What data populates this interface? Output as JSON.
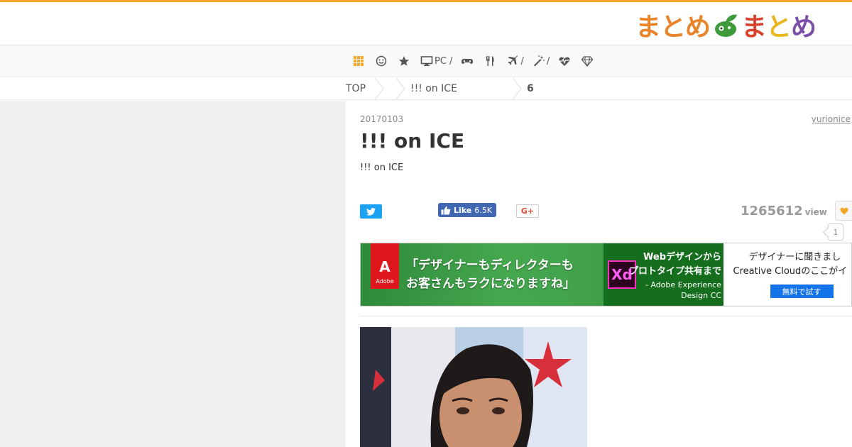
{
  "colors": {
    "accent": "#f5a623",
    "twitter": "#1da1f2",
    "facebook": "#4267b2",
    "google": "#dd4b39"
  },
  "logo": {
    "text_1": "まとめ",
    "text_2": "まとめ"
  },
  "nav": {
    "items": [
      {
        "icon": "grid-icon",
        "label": ""
      },
      {
        "icon": "smiley-icon",
        "label": ""
      },
      {
        "icon": "star-icon",
        "label": ""
      },
      {
        "icon": "monitor-icon",
        "label": "PC /"
      },
      {
        "icon": "gamepad-icon",
        "label": ""
      },
      {
        "icon": "utensils-icon",
        "label": ""
      },
      {
        "icon": "plane-icon",
        "label": "/"
      },
      {
        "icon": "magic-wand-icon",
        "label": "/"
      },
      {
        "icon": "heartbeat-icon",
        "label": ""
      },
      {
        "icon": "gem-icon",
        "label": ""
      }
    ]
  },
  "breadcrumb": {
    "top": "TOP",
    "category": "!!! on ICE",
    "current": "6"
  },
  "article": {
    "date": "20170103",
    "author": "yurionice",
    "title": "!!! on ICE",
    "description": "!!! on ICE",
    "views": "1265612",
    "views_unit": "view",
    "fav_count": "1"
  },
  "share": {
    "fb_label": "Like",
    "fb_count": "6.5K",
    "gplus_label": "G+"
  },
  "ad": {
    "brand": "Adobe",
    "copy_line1": "「デザイナーもディレクターも",
    "copy_line2": "お客さんもラクになりますね」",
    "xd_label": "Xd",
    "xd_line1": "Webデザインから",
    "xd_line2": "プロトタイプ共有まで",
    "xd_line3": "- Adobe Experience",
    "xd_line4": "Design CC",
    "right_line1": "デザイナーに聞きまし",
    "right_line2": "Creative Cloudのここがイ",
    "cta": "無料で試す"
  }
}
